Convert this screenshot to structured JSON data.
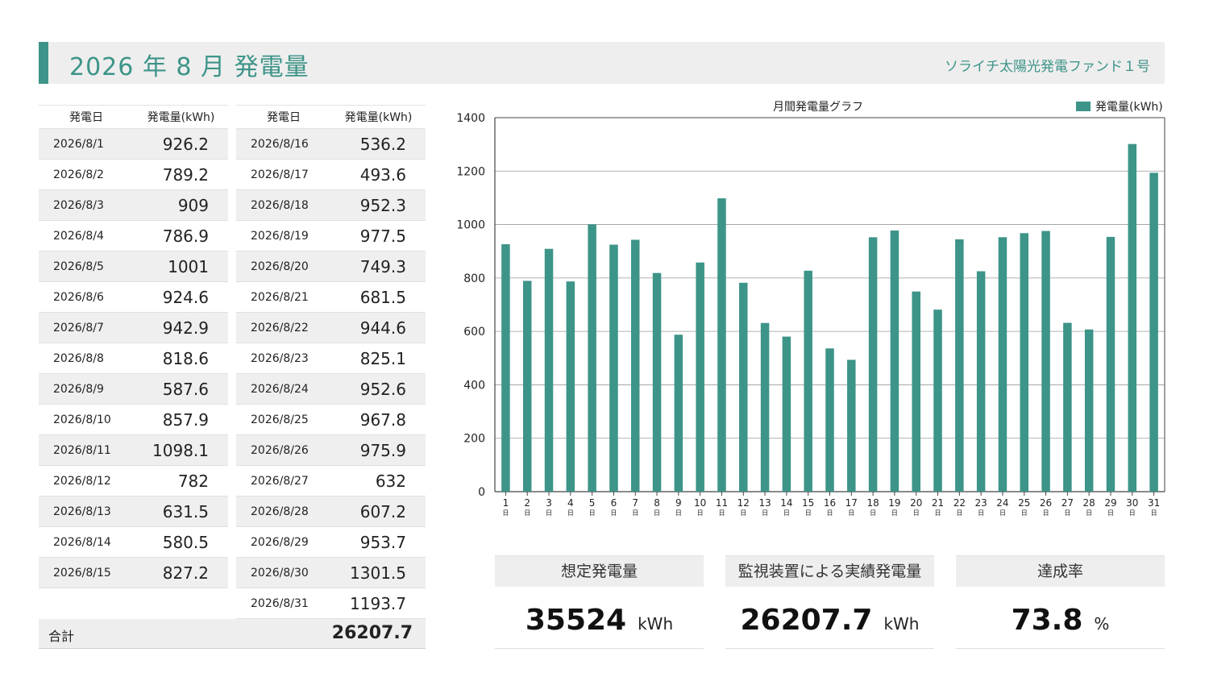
{
  "header": {
    "title": "2026 年 8 月 発電量",
    "fund_name": "ソライチ太陽光発電ファンド１号"
  },
  "colors": {
    "accent": "#3d9488",
    "header_bg": "#eeeeee",
    "row_stripe": "#efefef"
  },
  "table": {
    "date_header": "発電日",
    "value_header": "発電量(kWh)",
    "left_rows": [
      {
        "date": "2026/8/1",
        "value": "926.2"
      },
      {
        "date": "2026/8/2",
        "value": "789.2"
      },
      {
        "date": "2026/8/3",
        "value": "909"
      },
      {
        "date": "2026/8/4",
        "value": "786.9"
      },
      {
        "date": "2026/8/5",
        "value": "1001"
      },
      {
        "date": "2026/8/6",
        "value": "924.6"
      },
      {
        "date": "2026/8/7",
        "value": "942.9"
      },
      {
        "date": "2026/8/8",
        "value": "818.6"
      },
      {
        "date": "2026/8/9",
        "value": "587.6"
      },
      {
        "date": "2026/8/10",
        "value": "857.9"
      },
      {
        "date": "2026/8/11",
        "value": "1098.1"
      },
      {
        "date": "2026/8/12",
        "value": "782"
      },
      {
        "date": "2026/8/13",
        "value": "631.5"
      },
      {
        "date": "2026/8/14",
        "value": "580.5"
      },
      {
        "date": "2026/8/15",
        "value": "827.2"
      }
    ],
    "right_rows": [
      {
        "date": "2026/8/16",
        "value": "536.2"
      },
      {
        "date": "2026/8/17",
        "value": "493.6"
      },
      {
        "date": "2026/8/18",
        "value": "952.3"
      },
      {
        "date": "2026/8/19",
        "value": "977.5"
      },
      {
        "date": "2026/8/20",
        "value": "749.3"
      },
      {
        "date": "2026/8/21",
        "value": "681.5"
      },
      {
        "date": "2026/8/22",
        "value": "944.6"
      },
      {
        "date": "2026/8/23",
        "value": "825.1"
      },
      {
        "date": "2026/8/24",
        "value": "952.6"
      },
      {
        "date": "2026/8/25",
        "value": "967.8"
      },
      {
        "date": "2026/8/26",
        "value": "975.9"
      },
      {
        "date": "2026/8/27",
        "value": "632"
      },
      {
        "date": "2026/8/28",
        "value": "607.2"
      },
      {
        "date": "2026/8/29",
        "value": "953.7"
      },
      {
        "date": "2026/8/30",
        "value": "1301.5"
      },
      {
        "date": "2026/8/31",
        "value": "1193.7"
      }
    ],
    "total_label": "合計",
    "total_value": "26207.7"
  },
  "chart_data": {
    "type": "bar",
    "title": "月間発電量グラフ",
    "legend": "発電量(kWh)",
    "legend_position": "top-right",
    "grid": true,
    "ylim": [
      0,
      1400
    ],
    "yticks": [
      0,
      200,
      400,
      600,
      800,
      1000,
      1200,
      1400
    ],
    "categories": [
      "1",
      "2",
      "3",
      "4",
      "5",
      "6",
      "7",
      "8",
      "9",
      "10",
      "11",
      "12",
      "13",
      "14",
      "15",
      "16",
      "17",
      "18",
      "19",
      "20",
      "21",
      "22",
      "23",
      "24",
      "25",
      "26",
      "27",
      "28",
      "29",
      "30",
      "31"
    ],
    "category_suffix": "日",
    "values": [
      926.2,
      789.2,
      909,
      786.9,
      1001,
      924.6,
      942.9,
      818.6,
      587.6,
      857.9,
      1098.1,
      782,
      631.5,
      580.5,
      827.2,
      536.2,
      493.6,
      952.3,
      977.5,
      749.3,
      681.5,
      944.6,
      825.1,
      952.6,
      967.8,
      975.9,
      632,
      607.2,
      953.7,
      1301.5,
      1193.7
    ],
    "bar_color": "#3d9488"
  },
  "summary": {
    "expected": {
      "label": "想定発電量",
      "value": "35524",
      "unit": "kWh"
    },
    "actual": {
      "label": "監視装置による実績発電量",
      "value": "26207.7",
      "unit": "kWh"
    },
    "rate": {
      "label": "達成率",
      "value": "73.8",
      "unit": "%"
    }
  }
}
